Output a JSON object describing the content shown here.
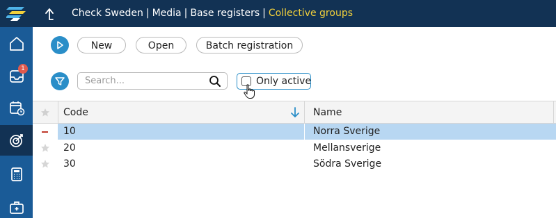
{
  "app": {
    "breadcrumb": {
      "items": [
        "Check Sweden",
        "Media",
        "Base registers"
      ],
      "current": "Collective groups",
      "separator": "|"
    }
  },
  "sidebar": {
    "items": [
      {
        "icon": "home-icon"
      },
      {
        "icon": "inbox-icon",
        "badge": "1"
      },
      {
        "icon": "calendar-clock-icon"
      },
      {
        "icon": "target-icon",
        "active": true
      },
      {
        "icon": "calculator-icon"
      },
      {
        "icon": "toolbox-icon"
      }
    ]
  },
  "toolbar": {
    "run_icon": "play-icon",
    "new_label": "New",
    "open_label": "Open",
    "batch_label": "Batch registration"
  },
  "filter": {
    "filter_icon": "filter-icon",
    "search_placeholder": "Search...",
    "search_value": "",
    "only_active_label": "Only active",
    "only_active_checked": false
  },
  "grid": {
    "columns": [
      "Code",
      "Name"
    ],
    "sort": {
      "column": "Code",
      "direction": "descending-arrow"
    },
    "rows": [
      {
        "code": "10",
        "name": "Norra Sverige",
        "selected": true
      },
      {
        "code": "20",
        "name": "Mellansverige",
        "selected": false
      },
      {
        "code": "30",
        "name": "Södra Sverige",
        "selected": false
      }
    ]
  },
  "colors": {
    "topbar": "#123254",
    "sidebar": "#1a5b97",
    "accent": "#2a8ec8",
    "breadcrumb_current": "#f2d03b",
    "selected_row": "#b8d7f2",
    "badge": "#e05a4e"
  }
}
